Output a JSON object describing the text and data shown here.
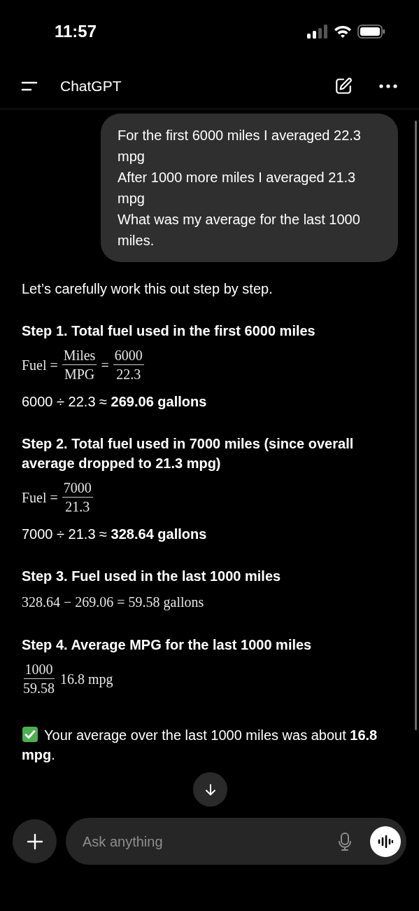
{
  "status_bar": {
    "time": "11:57"
  },
  "header": {
    "title": "ChatGPT"
  },
  "user_message": {
    "lines": [
      "For the first 6000 miles I averaged 22.3 mpg",
      "After 1000 more miles I averaged 21.3 mpg",
      "What was my average for the last 1000 miles."
    ]
  },
  "response": [
    {
      "kind": "paragraph",
      "text": "Let’s carefully work this out step by step."
    },
    {
      "kind": "heading",
      "text": "Step 1. Total fuel used in the first 6000 miles"
    },
    {
      "kind": "math",
      "parts": [
        {
          "kind": "text",
          "text": "Fuel ="
        },
        {
          "kind": "frac",
          "num": "Miles",
          "den": "MPG"
        },
        {
          "kind": "text",
          "text": "="
        },
        {
          "kind": "frac",
          "num": "6000",
          "den": "22.3"
        }
      ]
    },
    {
      "kind": "paragraph",
      "text": "6000 ÷ 22.3 ≈ **269.06 gallons**"
    },
    {
      "kind": "heading",
      "text": "Step 2. Total fuel used in 7000 miles (since overall average dropped to 21.3 mpg)"
    },
    {
      "kind": "math",
      "parts": [
        {
          "kind": "text",
          "text": "Fuel ="
        },
        {
          "kind": "frac",
          "num": "7000",
          "den": "21.3"
        }
      ]
    },
    {
      "kind": "paragraph",
      "text": "7000 ÷ 21.3 ≈ **328.64 gallons**"
    },
    {
      "kind": "heading",
      "text": "Step 3. Fuel used in the last 1000 miles"
    },
    {
      "kind": "math",
      "parts": [
        {
          "kind": "text",
          "text": "328.64 − 269.06 = 59.58 gallons"
        }
      ]
    },
    {
      "kind": "heading",
      "text": "Step 4. Average MPG for the last 1000 miles"
    },
    {
      "kind": "math",
      "parts": [
        {
          "kind": "frac",
          "num": "1000",
          "den": "59.58"
        },
        {
          "kind": "text",
          "text": "16.8 mpg"
        }
      ]
    },
    {
      "kind": "check_paragraph",
      "text": "Your average over the last 1000 miles was about **16.8 mpg**."
    }
  ],
  "composer": {
    "placeholder": "Ask anything"
  }
}
